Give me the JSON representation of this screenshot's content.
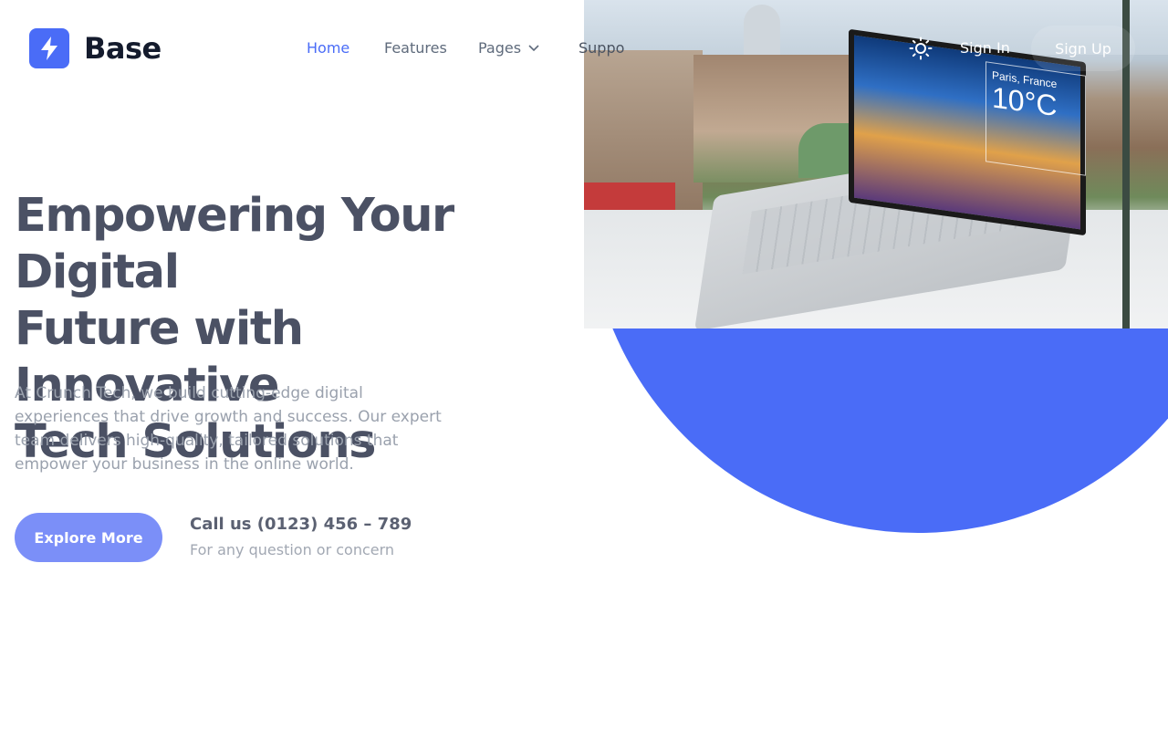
{
  "brand": {
    "name": "Base",
    "logo_icon": "bolt-icon",
    "accent": "#4a6cf7"
  },
  "nav": {
    "items": [
      {
        "label": "Home",
        "active": true
      },
      {
        "label": "Features",
        "active": false
      },
      {
        "label": "Pages",
        "active": false,
        "has_dropdown": true
      },
      {
        "label": "Suppo",
        "active": false
      }
    ]
  },
  "header_actions": {
    "theme_icon": "sun-icon",
    "sign_in": "Sign In",
    "sign_up": "Sign Up"
  },
  "hero": {
    "headline_lines": [
      "Empowering Your Digital",
      "Future with Innovative",
      "Tech Solutions"
    ],
    "description": "At Crunch Tech, we build cutting-edge digital experiences that drive growth and success. Our expert team delivers high-quality, tailored solutions that empower your business in the online world.",
    "cta": "Explore More",
    "call_title": "Call us (0123) 456 – 789",
    "call_subtitle": "For any question or concern"
  },
  "hero_image": {
    "weather_city": "Paris, France",
    "weather_temp": "10°C"
  }
}
